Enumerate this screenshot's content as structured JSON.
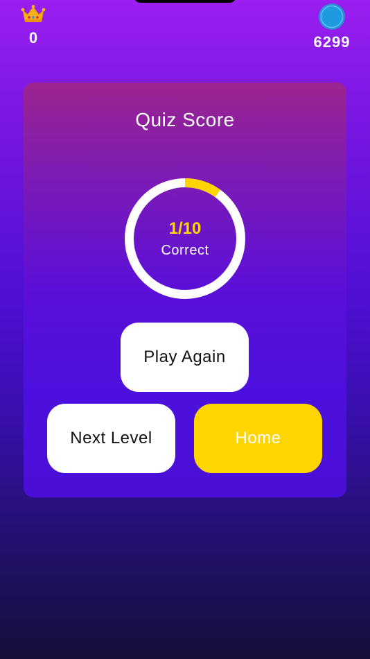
{
  "header": {
    "crown_icon": "crown-icon",
    "crown_count": "0",
    "coin_icon": "coin-icon",
    "coin_count": "6299"
  },
  "quiz": {
    "title": "Quiz Score",
    "score_text": "1/10",
    "score_label": "Correct",
    "progress_fraction": 0.1
  },
  "buttons": {
    "play_again": "Play Again",
    "next_level": "Next Level",
    "home": "Home"
  },
  "colors": {
    "accent_yellow": "#ffd500",
    "ring_track": "#ffffff",
    "ring_progress": "#ffd400",
    "coin_blue": "#1e9be0"
  }
}
